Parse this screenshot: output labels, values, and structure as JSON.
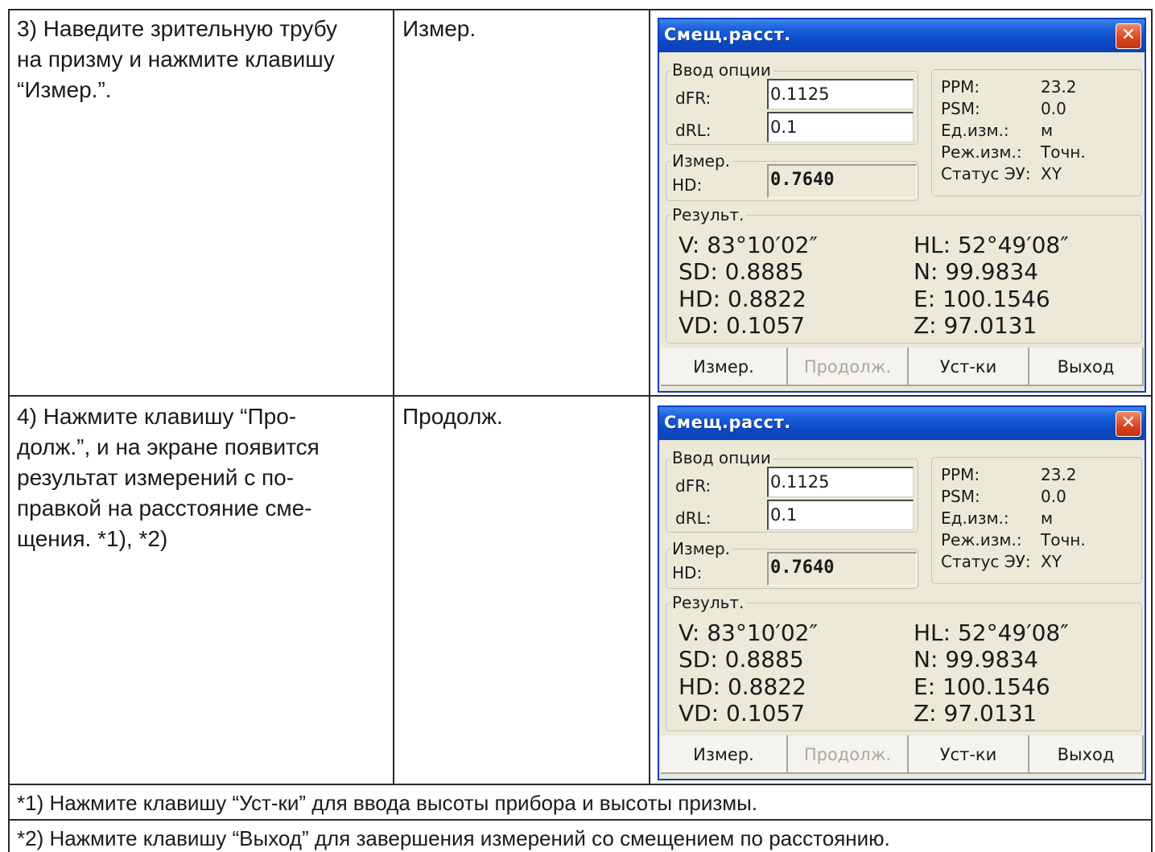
{
  "rows": [
    {
      "step_lines": [
        "3) Наведите зрительную трубу",
        "на призму и нажмите клавишу",
        "“Измер.”."
      ],
      "key": "Измер."
    },
    {
      "step_lines": [
        "4) Нажмите клавишу “Про-",
        "долж.”, и на экране появится",
        "результат измерений с по-",
        "правкой на расстояние сме-",
        "щения. *1), *2)"
      ],
      "key": "Продолж."
    }
  ],
  "notes": [
    "*1) Нажмите клавишу “Уст-ки” для ввода высоты прибора и высоты призмы.",
    "*2) Нажмите клавишу “Выход” для завершения измерений со смещением по расстоянию."
  ],
  "dialog": {
    "title": "Смещ.расст.",
    "close_glyph": "✕",
    "input_group": {
      "legend": "Ввод опции",
      "dfr_label": "dFR:",
      "dfr_value": "0.1125",
      "drl_label": "dRL:",
      "drl_value": "0.1"
    },
    "measure_group": {
      "legend": "Измер.",
      "hd_label": "HD:",
      "hd_value": "0.7640"
    },
    "info_group": {
      "ppm_label": "PPM:",
      "ppm_value": "23.2",
      "psm_label": "PSM:",
      "psm_value": "0.0",
      "unit_label": "Ед.изм.:",
      "unit_value": "м",
      "mode_label": "Реж.изм.:",
      "mode_value": "Точн.",
      "status_label": "Статус ЭУ:",
      "status_value": "XY"
    },
    "result_group": {
      "legend": "Результ.",
      "v": "V:  83°10′02″",
      "sd": "SD: 0.8885",
      "hd": "HD: 0.8822",
      "vd": "VD: 0.1057",
      "hl": "HL:  52°49′08″",
      "n": "N: 99.9834",
      "e": "E: 100.1546",
      "z": "Z: 97.0131"
    },
    "buttons": {
      "measure": "Измер.",
      "continue": "Продолж.",
      "settings": "Уст-ки",
      "exit": "Выход"
    }
  }
}
